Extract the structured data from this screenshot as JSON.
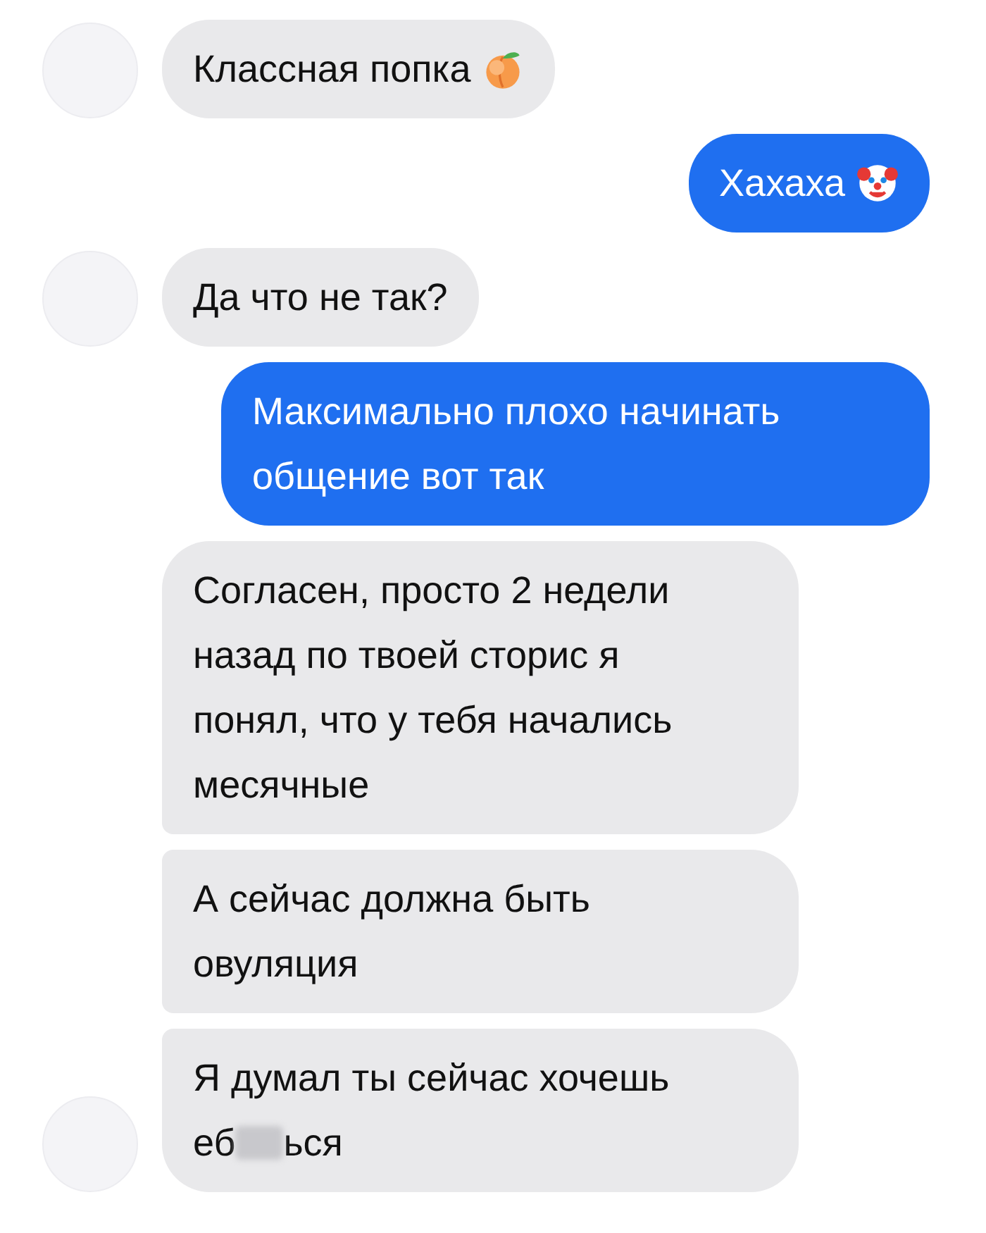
{
  "messages": [
    {
      "kind": "incoming",
      "avatar": true,
      "text": "Классная попка",
      "emoji": true
    },
    {
      "kind": "outgoing",
      "text": "Хахаха",
      "emoji": true
    },
    {
      "kind": "incoming",
      "avatar": true,
      "text": "Да что не так?"
    },
    {
      "kind": "outgoing",
      "text": "Максимально плохо начинать общение вот так"
    },
    {
      "kind": "incoming",
      "avatar": false,
      "text": "Согласен, просто 2 недели назад по твоей сторис я понял, что у тебя начались месячные"
    },
    {
      "kind": "incoming",
      "avatar": false,
      "text": "А сейчас должна быть овуляция"
    },
    {
      "kind": "incoming",
      "avatar": true,
      "lines": [
        "Я думал ты сейчас хочешь",
        "еб"
      ],
      "redacted": true,
      "text_after": "ься"
    }
  ]
}
